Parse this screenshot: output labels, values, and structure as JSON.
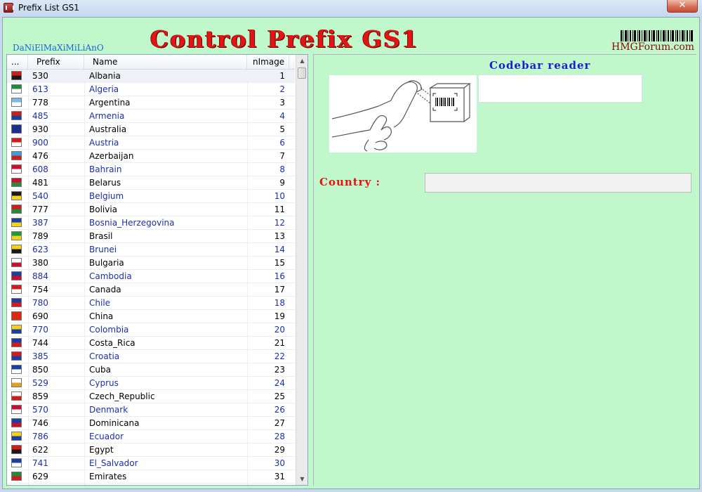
{
  "window": {
    "title": "Prefix List GS1"
  },
  "banner": {
    "title": "Control Prefix GS1",
    "author": "DaNiElMaXiMiLiAnO",
    "site": "HMGForum.com"
  },
  "grid": {
    "columns": [
      "...",
      "Prefix",
      "Name",
      "nImage"
    ],
    "rows": [
      {
        "prefix": "530",
        "name": "Albania",
        "img": "1",
        "flag": [
          "#d01c1c",
          "#1a1a1a"
        ]
      },
      {
        "prefix": "613",
        "name": "Algeria",
        "img": "2",
        "flag": [
          "#1f8a3a",
          "#ffffff"
        ]
      },
      {
        "prefix": "778",
        "name": "Argentina",
        "img": "3",
        "flag": [
          "#7fb8e6",
          "#ffffff"
        ]
      },
      {
        "prefix": "485",
        "name": "Armenia",
        "img": "4",
        "flag": [
          "#d21c1c",
          "#1b3fa0"
        ]
      },
      {
        "prefix": "930",
        "name": "Australia",
        "img": "5",
        "flag": [
          "#1b2e8a",
          "#1b2e8a"
        ]
      },
      {
        "prefix": "900",
        "name": "Austria",
        "img": "6",
        "flag": [
          "#d21c1c",
          "#ffffff"
        ]
      },
      {
        "prefix": "476",
        "name": "Azerbaijan",
        "img": "7",
        "flag": [
          "#3aa0d6",
          "#d21c1c"
        ]
      },
      {
        "prefix": "608",
        "name": "Bahrain",
        "img": "8",
        "flag": [
          "#c8102e",
          "#ffffff"
        ]
      },
      {
        "prefix": "481",
        "name": "Belarus",
        "img": "9",
        "flag": [
          "#c8102e",
          "#2e8a3a"
        ]
      },
      {
        "prefix": "540",
        "name": "Belgium",
        "img": "10",
        "flag": [
          "#1a1a1a",
          "#f2d21b"
        ]
      },
      {
        "prefix": "777",
        "name": "Bolivia",
        "img": "11",
        "flag": [
          "#d21c1c",
          "#1f8a3a"
        ]
      },
      {
        "prefix": "387",
        "name": "Bosnia_Herzegovina",
        "img": "12",
        "flag": [
          "#1b3fa0",
          "#f2d21b"
        ]
      },
      {
        "prefix": "789",
        "name": "Brasil",
        "img": "13",
        "flag": [
          "#1f9a3a",
          "#f2d21b"
        ]
      },
      {
        "prefix": "623",
        "name": "Brunei",
        "img": "14",
        "flag": [
          "#f2d21b",
          "#1a1a1a"
        ]
      },
      {
        "prefix": "380",
        "name": "Bulgaria",
        "img": "15",
        "flag": [
          "#ffffff",
          "#c8102e"
        ]
      },
      {
        "prefix": "884",
        "name": "Cambodia",
        "img": "16",
        "flag": [
          "#1b3fa0",
          "#c8102e"
        ]
      },
      {
        "prefix": "754",
        "name": "Canada",
        "img": "17",
        "flag": [
          "#d21c1c",
          "#ffffff"
        ]
      },
      {
        "prefix": "780",
        "name": "Chile",
        "img": "18",
        "flag": [
          "#1b3fa0",
          "#d21c1c"
        ]
      },
      {
        "prefix": "690",
        "name": "China",
        "img": "19",
        "flag": [
          "#de2910",
          "#de2910"
        ]
      },
      {
        "prefix": "770",
        "name": "Colombia",
        "img": "20",
        "flag": [
          "#f2d21b",
          "#1b3fa0"
        ]
      },
      {
        "prefix": "744",
        "name": "Costa_Rica",
        "img": "21",
        "flag": [
          "#1b3fa0",
          "#d21c1c"
        ]
      },
      {
        "prefix": "385",
        "name": "Croatia",
        "img": "22",
        "flag": [
          "#d21c1c",
          "#1b3fa0"
        ]
      },
      {
        "prefix": "850",
        "name": "Cuba",
        "img": "23",
        "flag": [
          "#1b3fa0",
          "#ffffff"
        ]
      },
      {
        "prefix": "529",
        "name": "Cyprus",
        "img": "24",
        "flag": [
          "#ffffff",
          "#e0a020"
        ]
      },
      {
        "prefix": "859",
        "name": "Czech_Republic",
        "img": "25",
        "flag": [
          "#ffffff",
          "#d21c1c"
        ]
      },
      {
        "prefix": "570",
        "name": "Denmark",
        "img": "26",
        "flag": [
          "#c8102e",
          "#ffffff"
        ]
      },
      {
        "prefix": "746",
        "name": "Dominicana",
        "img": "27",
        "flag": [
          "#1b3fa0",
          "#c8102e"
        ]
      },
      {
        "prefix": "786",
        "name": "Ecuador",
        "img": "28",
        "flag": [
          "#f2d21b",
          "#1b3fa0"
        ]
      },
      {
        "prefix": "622",
        "name": "Egypt",
        "img": "29",
        "flag": [
          "#d21c1c",
          "#1a1a1a"
        ]
      },
      {
        "prefix": "741",
        "name": "El_Salvador",
        "img": "30",
        "flag": [
          "#1b3fa0",
          "#ffffff"
        ]
      },
      {
        "prefix": "629",
        "name": "Emirates",
        "img": "31",
        "flag": [
          "#1f8a3a",
          "#d21c1c"
        ]
      }
    ]
  },
  "right_panel": {
    "reader_label": "Codebar reader",
    "barcode_value": "",
    "country_label": "Country :",
    "country_value": ""
  }
}
